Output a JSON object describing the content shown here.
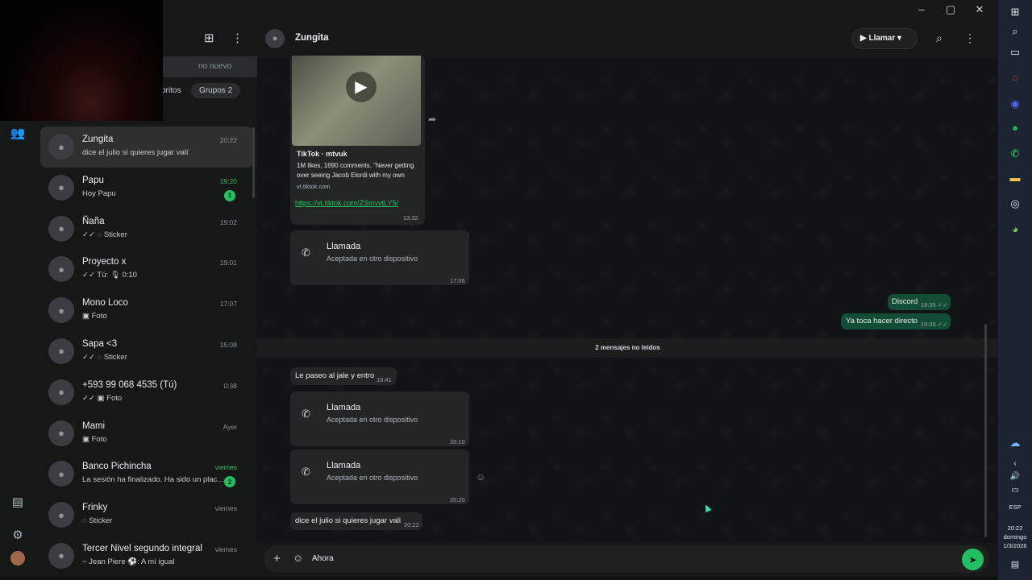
{
  "window": {
    "minimize": "–",
    "maximize": "▢",
    "close": "✕"
  },
  "list": {
    "search_placeholder": "no nuevo",
    "filters": {
      "favorites": "oritos",
      "groups": "Grupos 2"
    },
    "chats": [
      {
        "name": "Zungita",
        "preview": "dice el julio si quieres jugar valí",
        "time": "20:22",
        "active": true
      },
      {
        "name": "Papu",
        "preview": "Hoy Papu",
        "time": "19:20",
        "unread": "1",
        "green": true
      },
      {
        "name": "Ñaña",
        "preview": "✓✓ ◌ Sticker",
        "time": "19:02"
      },
      {
        "name": "Proyecto x",
        "preview": "✓✓ Tú: 🎙 0:10",
        "time": "19:01"
      },
      {
        "name": "Mono Loco",
        "preview": "▣ Foto",
        "time": "17:07"
      },
      {
        "name": "Sapa <3",
        "preview": "✓✓ ◌ Sticker",
        "time": "15:08"
      },
      {
        "name": "+593 99 068 4535 (Tú)",
        "preview": "✓✓ ▣ Foto",
        "time": "0:38"
      },
      {
        "name": "Mami",
        "preview": "▣ Foto",
        "time": "Ayer"
      },
      {
        "name": "Banco Pichincha",
        "preview": "La sesión ha finalizado. Ha sido un placer…",
        "time": "viernes",
        "unread": "2",
        "green": true
      },
      {
        "name": "Frinky",
        "preview": "◌ Sticker",
        "time": "viernes"
      },
      {
        "name": "Tercer Nivel segundo integral",
        "preview": "~ Jean Piere ⚽: A mí igual",
        "time": "viernes"
      }
    ]
  },
  "conversation": {
    "title": "Zungita",
    "call_label": "Llamar",
    "link_preview": {
      "title": "TikTok · mtvuk",
      "desc": "1M likes, 1690 comments. \"Never getting over seeing Jacob Elordi with my own",
      "domain": "vt.tiktok.com",
      "url": "https://vt.tiktok.com/ZSmvvtLY5/",
      "time": "13:32"
    },
    "call1": {
      "title": "Llamada",
      "status": "Aceptada en otro dispositivo",
      "time": "17:06"
    },
    "out1": {
      "text": "Discord",
      "time": "19:35 ✓✓"
    },
    "out2": {
      "text": "Ya toca hacer directo",
      "time": "19:35 ✓✓"
    },
    "unread_divider": "2 mensajes no leídos",
    "in1": {
      "text": "Le paseo al jale y entro",
      "time": "19:41"
    },
    "call2": {
      "title": "Llamada",
      "status": "Aceptada en otro dispositivo",
      "time": "20:10"
    },
    "call3": {
      "title": "Llamada",
      "status": "Aceptada en otro dispositivo",
      "time": "20:20"
    },
    "in2": {
      "text": "dice el julio si quieres jugar vali",
      "time": "20:22"
    },
    "composer_value": "Ahora"
  },
  "taskbar": {
    "lang": "ESP",
    "time": "20:22",
    "day": "domingo",
    "date": "1/3/2026"
  },
  "colors": {
    "accent": "#21c063",
    "outgoing": "#144d37",
    "incoming": "#242626"
  }
}
